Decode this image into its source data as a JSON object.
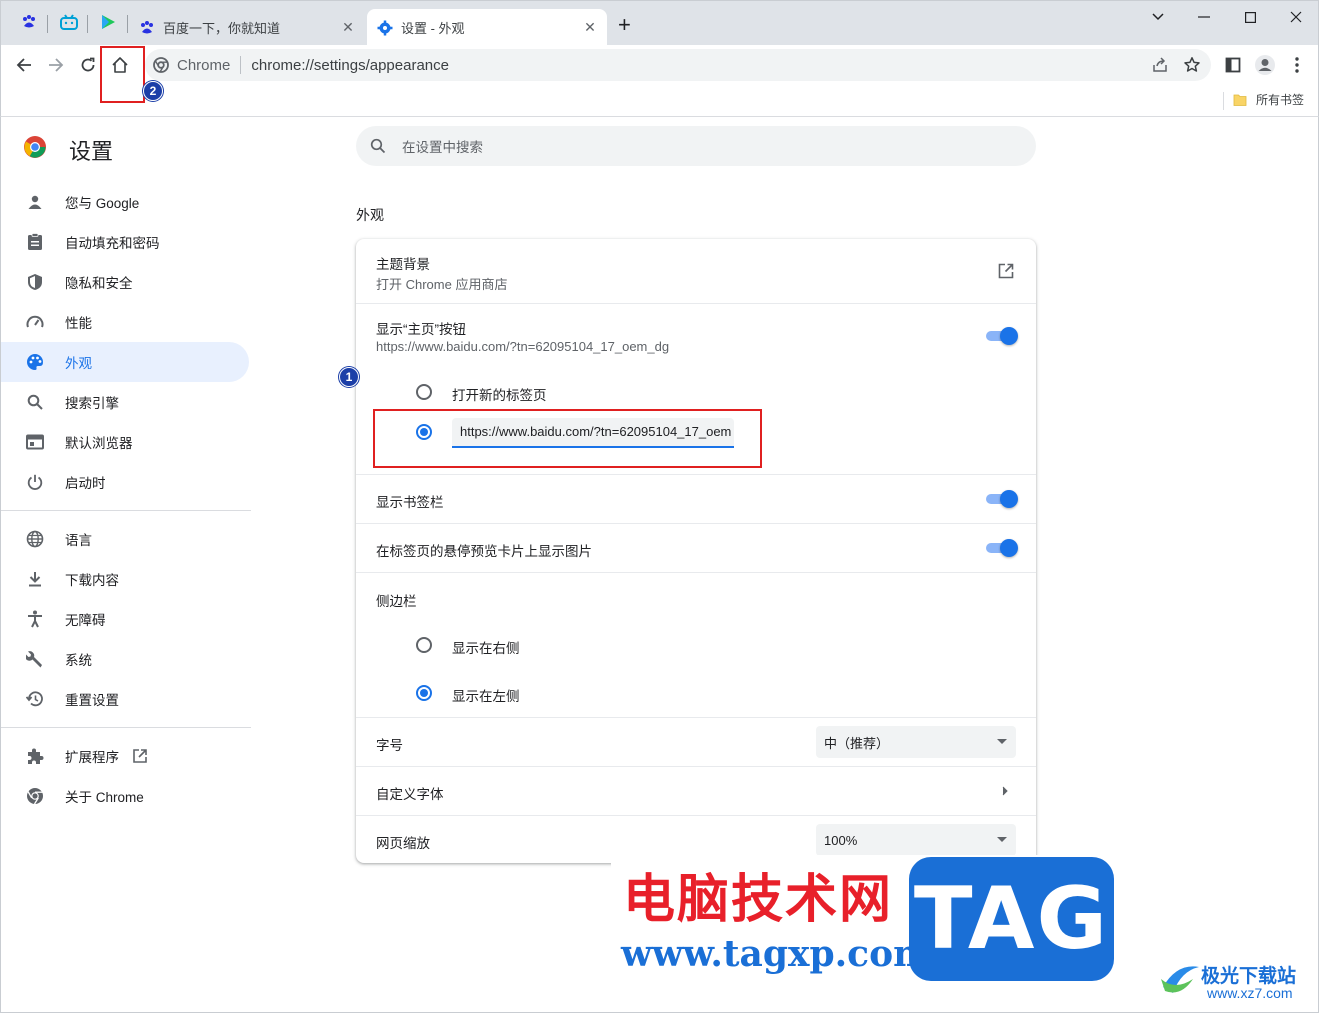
{
  "tabs": [
    {
      "title": "百度一下，你就知道"
    },
    {
      "title": "设置 - 外观",
      "active": true
    }
  ],
  "omnibox": {
    "site_label": "Chrome",
    "url": "chrome://settings/appearance"
  },
  "bookmarks_bar": {
    "folder_label": "所有书签"
  },
  "settings": {
    "header_title": "设置",
    "search_placeholder": "在设置中搜索",
    "nav": {
      "group1": [
        "您与 Google",
        "自动填充和密码",
        "隐私和安全",
        "性能",
        "外观",
        "搜索引擎",
        "默认浏览器",
        "启动时"
      ],
      "group2": [
        "语言",
        "下载内容",
        "无障碍",
        "系统",
        "重置设置"
      ],
      "group3": [
        "扩展程序",
        "关于 Chrome"
      ],
      "selected": "外观"
    },
    "section_title": "外观",
    "theme": {
      "label": "主题背景",
      "sublabel": "打开 Chrome 应用商店"
    },
    "home_button": {
      "label": "显示“主页”按钮",
      "sublabel": "https://www.baidu.com/?tn=62095104_17_oem_dg",
      "enabled": true,
      "option_new_tab": "打开新的标签页",
      "custom_url_value": "https://www.baidu.com/?tn=62095104_17_oem"
    },
    "bookmarks_bar": {
      "label": "显示书签栏",
      "enabled": true
    },
    "hover_preview": {
      "label": "在标签页的悬停预览卡片上显示图片",
      "enabled": true
    },
    "side_panel": {
      "label": "侧边栏",
      "option_right": "显示在右侧",
      "option_left": "显示在左侧",
      "selected": "left"
    },
    "font_size": {
      "label": "字号",
      "value": "中（推荐）"
    },
    "custom_fonts": {
      "label": "自定义字体"
    },
    "page_zoom": {
      "label": "网页缩放",
      "value": "100%"
    }
  },
  "annotations": {
    "badge1": "1",
    "badge2": "2"
  },
  "watermark": {
    "cn_title": "电脑技术网",
    "url": "www.tagxp.com",
    "logo": "TAG",
    "site_name": "极光下载站",
    "site_url": "www.xz7.com"
  },
  "colors": {
    "accent": "#1a73e8",
    "selected_bg": "#e8f0fe",
    "annotation_red": "#e02020",
    "watermark_red": "#e8202a",
    "watermark_blue": "#1a6fd6"
  }
}
